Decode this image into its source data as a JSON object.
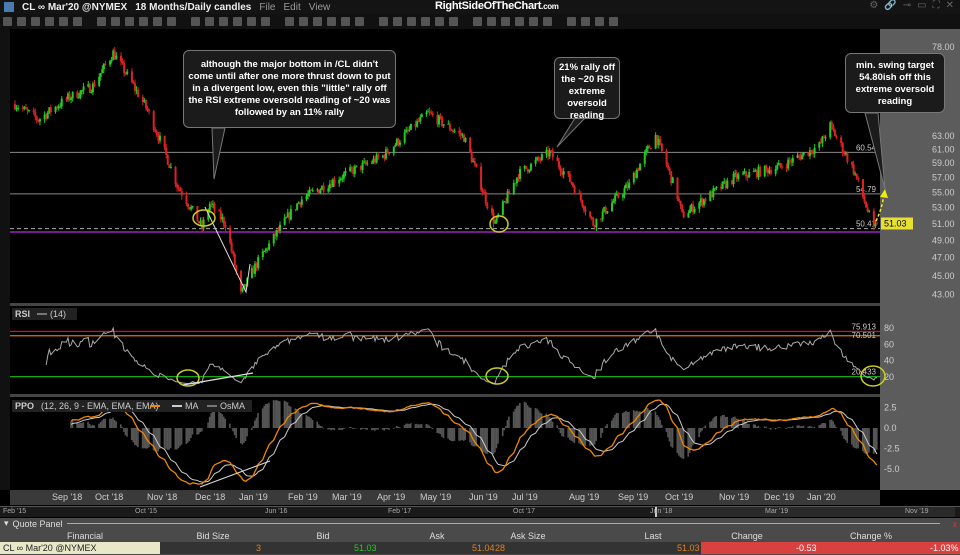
{
  "titlebar": {
    "symbol": "CL ∞ Mar'20 @NYMEX",
    "period": "18 Months/Daily candles",
    "menu": [
      "File",
      "Edit",
      "View"
    ],
    "logo": "RightSideOfTheChart",
    "logo_suffix": ".com"
  },
  "price_pane": {
    "axis_ticks": [
      78,
      63,
      61,
      59,
      57,
      55,
      53,
      51,
      49,
      47,
      45,
      43
    ],
    "scale": "log",
    "last_price": "51.03",
    "levels": [
      {
        "label": "60.54",
        "value": 60.54,
        "color": "#888888"
      },
      {
        "label": "54.79",
        "value": 54.79,
        "color": "#888888"
      },
      {
        "label": "50.41",
        "value": 50.41,
        "color": "#aaaaaa",
        "dashed": true
      }
    ],
    "support_line": {
      "value": 50.0,
      "color": "#a020c0"
    },
    "up_color": "#22cc22",
    "down_color": "#dd2222"
  },
  "annotations": {
    "left": "although the major bottom in /CL didn't come until after one more thrust down to put in a divergent low, even this \"little\" rally off the RSI extreme oversold reading of ~20 was followed by an 11% rally",
    "middle": "21% rally off the ~20 RSI extreme oversold reading",
    "right": "min. swing target 54.80ish off this extreme oversold reading"
  },
  "rsi_pane": {
    "label": "RSI",
    "params": "(14)",
    "axis_ticks": [
      80,
      60,
      40,
      20
    ],
    "levels": [
      {
        "label": "75.913",
        "value": 75.913,
        "color": "#cc1133"
      },
      {
        "label": "70.501",
        "value": 70.501,
        "color": "#dd7700"
      },
      {
        "label": "20.433",
        "value": 20.433,
        "color": "#11aa11"
      }
    ]
  },
  "ppo_pane": {
    "label": "PPO",
    "params": "(12, 26, 9 - EMA, EMA, EMA)",
    "legend": [
      "MA",
      "OsMA"
    ],
    "axis_ticks": [
      "2.5",
      "0.0",
      "-2.5",
      "-5.0"
    ],
    "line_color": "#ee8800",
    "ma_color": "#cccccc"
  },
  "chart_data": {
    "type": "candlestick",
    "symbol": "CL Mar'20",
    "price_path": [
      [
        "2018-08-01",
        68
      ],
      [
        "2018-08-16",
        65.5
      ],
      [
        "2018-09-04",
        69
      ],
      [
        "2018-09-20",
        71
      ],
      [
        "2018-10-03",
        76.9
      ],
      [
        "2018-10-25",
        67
      ],
      [
        "2018-11-13",
        56
      ],
      [
        "2018-11-29",
        50.5
      ],
      [
        "2018-12-04",
        53.5
      ],
      [
        "2018-12-14",
        51
      ],
      [
        "2018-12-24",
        43
      ],
      [
        "2019-01-02",
        46
      ],
      [
        "2019-01-31",
        54
      ],
      [
        "2019-02-25",
        57
      ],
      [
        "2019-03-25",
        60
      ],
      [
        "2019-04-23",
        66.5
      ],
      [
        "2019-05-16",
        62.8
      ],
      [
        "2019-05-31",
        53.5
      ],
      [
        "2019-06-05",
        51
      ],
      [
        "2019-06-20",
        57.5
      ],
      [
        "2019-07-10",
        60.5
      ],
      [
        "2019-07-25",
        56
      ],
      [
        "2019-08-07",
        51
      ],
      [
        "2019-08-30",
        56
      ],
      [
        "2019-09-16",
        63
      ],
      [
        "2019-09-30",
        54.5
      ],
      [
        "2019-10-03",
        52
      ],
      [
        "2019-11-06",
        57
      ],
      [
        "2019-12-05",
        58.5
      ],
      [
        "2019-12-30",
        61.5
      ],
      [
        "2020-01-06",
        64.5
      ],
      [
        "2020-01-21",
        58
      ],
      [
        "2020-02-03",
        50.2
      ],
      [
        "2020-02-05",
        51.03
      ]
    ]
  },
  "date_axis": [
    "Sep '18",
    "Oct '18",
    "Nov '18",
    "Dec '18",
    "Jan '19",
    "Feb '19",
    "Mar '19",
    "Apr '19",
    "May '19",
    "Jun '19",
    "Jul '19",
    "Aug '19",
    "Sep '19",
    "Oct '19",
    "Nov '19",
    "Dec '19",
    "Jan '20"
  ],
  "navigator": [
    "Feb '15",
    "Oct '15",
    "Jun '16",
    "Feb '17",
    "Oct '17",
    "Jun '18",
    "Mar '19",
    "Nov '19"
  ],
  "quote_panel": {
    "title": "Quote Panel",
    "columns": [
      "Financial Instrument",
      "Bid Size",
      "Bid",
      "Ask",
      "Ask Size",
      "Last",
      "Change",
      "Change %"
    ],
    "row": {
      "instrument": "CL ∞ Mar'20 @NYMEX",
      "bid_size": "3",
      "bid": "51.03",
      "ask": "51.04",
      "ask_size": "28",
      "last": "51.03",
      "change": "-0.53",
      "change_pct": "-1.03%"
    }
  }
}
